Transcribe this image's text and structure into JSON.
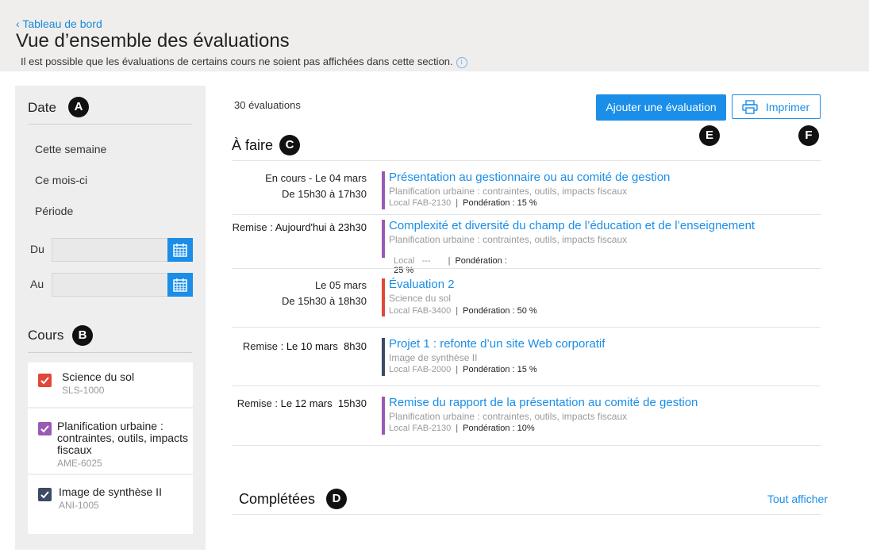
{
  "header": {
    "back_label": "Tableau de bord",
    "title": "Vue d’ensemble des évaluations",
    "note": "Il est possible que les évaluations de certains cours ne soient pas affichées dans cette section.",
    "info_glyph": "i"
  },
  "sidebar": {
    "date_title": "Date",
    "date_badge": "A",
    "filters": [
      "Cette semaine",
      "Ce mois-ci",
      "Période"
    ],
    "from_label": "Du",
    "to_label": "Au",
    "from_value": "",
    "to_value": "",
    "courses_title": "Cours",
    "courses_badge": "B",
    "courses": [
      {
        "name": "Science du sol",
        "code": "SLS-1000",
        "color": "#e0483a",
        "checked": true
      },
      {
        "name": "Planification urbaine : contraintes, outils, impacts fiscaux",
        "code": "AME-6025",
        "color": "#9b59b6",
        "checked": true
      },
      {
        "name": "Image de synthèse II",
        "code": "ANI-1005",
        "color": "#3d4a66",
        "checked": true
      }
    ]
  },
  "main": {
    "count": "30 évaluations",
    "add_button": "Ajouter une évaluation",
    "add_badge": "E",
    "print_button": "Imprimer",
    "print_badge": "F",
    "todo_title": "À faire",
    "todo_badge": "C",
    "completed_title": "Complétées",
    "completed_badge": "D",
    "show_all": "Tout afficher",
    "evaluations": [
      {
        "date_prefix": "",
        "date_line1": "En cours - Le 04 mars",
        "date_line2": "De 15h30 à 17h30",
        "title": "Présentation au gestionnaire ou au comité de gestion",
        "course": "Planification urbaine : contraintes, outils, impacts fiscaux",
        "local": "Local FAB-2130",
        "weight_label": "Pondération :",
        "weight": "15 %",
        "color": "#9b59b6"
      },
      {
        "date_prefix": "Remise : ",
        "date_line1": "Aujourd'hui à 23h30",
        "date_line2": "",
        "title": "Complexité et diversité du champ de l’éducation et de l’enseignement",
        "course": "Planification urbaine : contraintes, outils, impacts fiscaux",
        "local": "Local   ---",
        "weight_label": "Pondération :",
        "weight": "25 %",
        "color": "#9b59b6"
      },
      {
        "date_prefix": "",
        "date_line1": "Le 05 mars",
        "date_line2": "De 15h30 à 18h30",
        "title": "Évaluation 2",
        "course": "Science du sol",
        "local": "Local FAB-3400",
        "weight_label": "Pondération :",
        "weight": "50 %",
        "color": "#e0483a"
      },
      {
        "date_prefix": "Remise : ",
        "date_line1": "Le 10 mars  8h30",
        "date_line2": "",
        "title": "Projet 1 : refonte d’un site Web corporatif",
        "course": "Image de synthèse II",
        "local": "Local FAB-2000",
        "weight_label": "Pondération :",
        "weight": "15 %",
        "color": "#3d4a66"
      },
      {
        "date_prefix": "Remise : ",
        "date_line1": "Le 12 mars  15h30",
        "date_line2": "",
        "title": "Remise du rapport de la présentation au comité de gestion",
        "course": "Planification urbaine : contraintes, outils, impacts fiscaux",
        "local": "Local FAB-2130",
        "weight_label": "Pondération :",
        "weight": "10%",
        "color": "#9b59b6"
      }
    ]
  }
}
